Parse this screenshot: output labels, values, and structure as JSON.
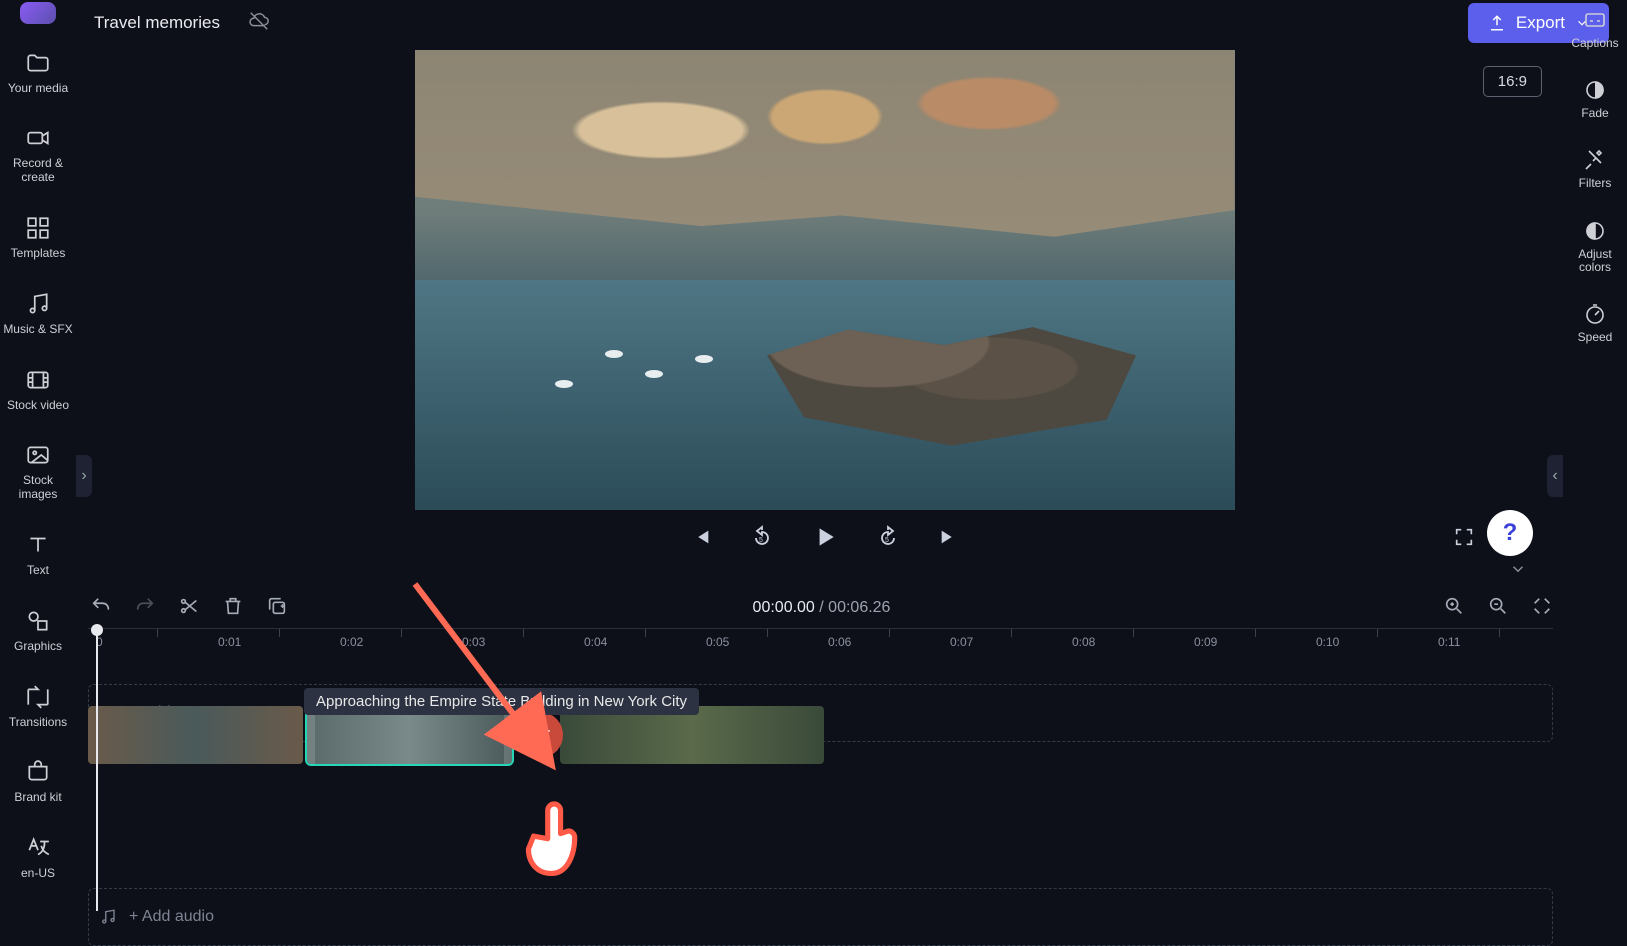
{
  "header": {
    "project_title": "Travel memories",
    "export_label": "Export",
    "aspect_ratio": "16:9"
  },
  "left_sidebar": {
    "items": [
      {
        "label": "Your media"
      },
      {
        "label": "Record & create"
      },
      {
        "label": "Templates"
      },
      {
        "label": "Music & SFX"
      },
      {
        "label": "Stock video"
      },
      {
        "label": "Stock images"
      },
      {
        "label": "Text"
      },
      {
        "label": "Graphics"
      },
      {
        "label": "Transitions"
      },
      {
        "label": "Brand kit"
      },
      {
        "label": "en-US"
      }
    ]
  },
  "right_sidebar": {
    "items": [
      {
        "label": "Captions"
      },
      {
        "label": "Fade"
      },
      {
        "label": "Filters"
      },
      {
        "label": "Adjust colors"
      },
      {
        "label": "Speed"
      }
    ]
  },
  "playback": {
    "current_time": "00:00.00",
    "separator": " / ",
    "total_time": "00:06.26"
  },
  "ruler": {
    "marks": [
      "0",
      "0:01",
      "0:02",
      "0:03",
      "0:04",
      "0:05",
      "0:06",
      "0:07",
      "0:08",
      "0:09",
      "0:10",
      "0:11"
    ]
  },
  "tracks": {
    "text_label": "+ Add text",
    "audio_label": "+ Add audio",
    "clip_tooltip": "Approaching the Empire State Building in New York City"
  },
  "help": {
    "glyph": "?"
  }
}
